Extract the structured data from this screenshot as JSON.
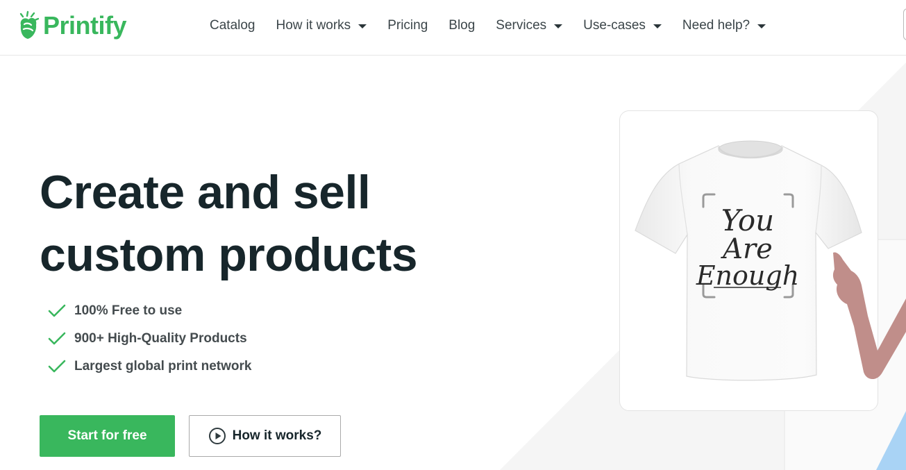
{
  "brand": {
    "name": "Printify",
    "color": "#39b75d"
  },
  "nav": {
    "items": [
      {
        "label": "Catalog",
        "has_dropdown": false
      },
      {
        "label": "How it works",
        "has_dropdown": true
      },
      {
        "label": "Pricing",
        "has_dropdown": false
      },
      {
        "label": "Blog",
        "has_dropdown": false
      },
      {
        "label": "Services",
        "has_dropdown": true
      },
      {
        "label": "Use-cases",
        "has_dropdown": true
      },
      {
        "label": "Need help?",
        "has_dropdown": true
      }
    ]
  },
  "hero": {
    "title_line1": "Create and sell",
    "title_line2": "custom products",
    "features": [
      "100% Free to use",
      "900+ High-Quality Products",
      "Largest global print network"
    ],
    "primary_cta": "Start for free",
    "secondary_cta": "How it works?"
  },
  "product_preview": {
    "design_text": [
      "You",
      "Are",
      "Enough"
    ]
  },
  "colors": {
    "accent": "#39b75d",
    "heading": "#17262b",
    "feature_text": "#444b4e",
    "hand": "#c08e8a",
    "blue_shape": "#a9d3f5"
  },
  "icons": {
    "feature_check": "check-icon",
    "play": "play-circle-icon",
    "dropdown": "caret-down-icon"
  }
}
